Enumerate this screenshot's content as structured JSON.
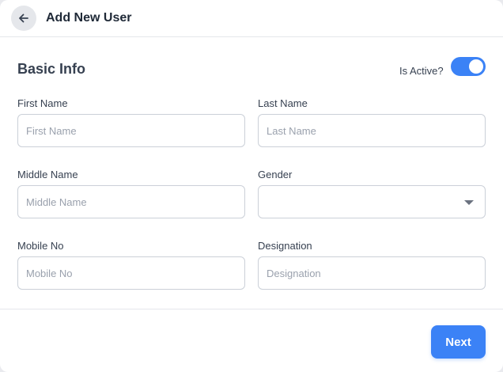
{
  "header": {
    "title": "Add New User",
    "back_icon": "arrow-left-icon"
  },
  "section": {
    "title": "Basic Info"
  },
  "active_toggle": {
    "label": "Is Active?",
    "checked": true,
    "color": "#3b82f6"
  },
  "fields": {
    "first_name": {
      "label": "First Name",
      "placeholder": "First Name",
      "value": ""
    },
    "last_name": {
      "label": "Last Name",
      "placeholder": "Last Name",
      "value": ""
    },
    "middle_name": {
      "label": "Middle Name",
      "placeholder": "Middle Name",
      "value": ""
    },
    "gender": {
      "label": "Gender",
      "value": ""
    },
    "mobile_no": {
      "label": "Mobile No",
      "placeholder": "Mobile No",
      "value": ""
    },
    "designation": {
      "label": "Designation",
      "placeholder": "Designation",
      "value": ""
    }
  },
  "footer": {
    "next_label": "Next"
  },
  "colors": {
    "accent": "#3b82f6",
    "border": "#cbd0d8",
    "text": "#374151"
  }
}
